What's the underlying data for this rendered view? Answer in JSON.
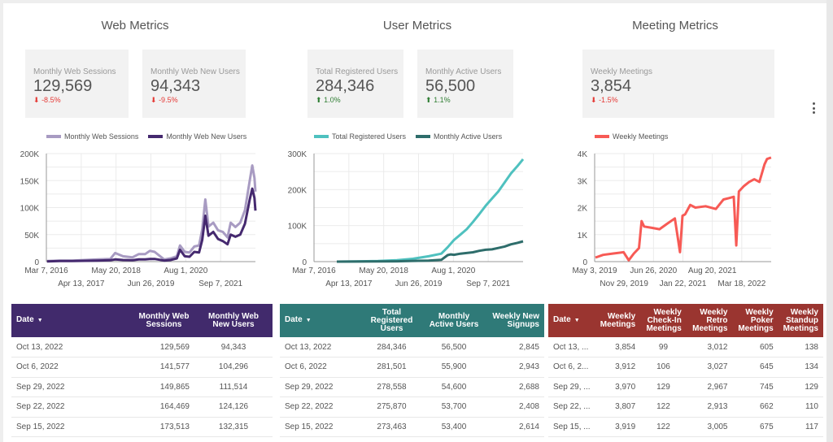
{
  "sections": [
    {
      "title": "Web Metrics",
      "kpis": [
        {
          "label": "Monthly Web Sessions",
          "value": "129,569",
          "delta": "-8.5%",
          "direction": "down",
          "icon": "arrow-down-icon"
        },
        {
          "label": "Monthly Web New Users",
          "value": "94,343",
          "delta": "-9.5%",
          "direction": "down",
          "icon": "arrow-down-icon"
        }
      ],
      "legend": [
        {
          "label": "Monthly Web Sessions",
          "color": "#a89bc2"
        },
        {
          "label": "Monthly Web New Users",
          "color": "#45296f"
        }
      ],
      "table": {
        "header_color": "#412a6c",
        "sort_icon": "sort-down-icon",
        "columns": [
          "Date",
          "Monthly Web Sessions",
          "Monthly Web New Users"
        ],
        "rows": [
          [
            "Oct 13, 2022",
            "129,569",
            "94,343"
          ],
          [
            "Oct 6, 2022",
            "141,577",
            "104,296"
          ],
          [
            "Sep 29, 2022",
            "149,865",
            "111,514"
          ],
          [
            "Sep 22, 2022",
            "164,469",
            "124,126"
          ],
          [
            "Sep 15, 2022",
            "173,513",
            "132,315"
          ]
        ]
      }
    },
    {
      "title": "User Metrics",
      "kpis": [
        {
          "label": "Total Registered Users",
          "value": "284,346",
          "delta": "1.0%",
          "direction": "up",
          "icon": "arrow-up-icon"
        },
        {
          "label": "Monthly Active Users",
          "value": "56,500",
          "delta": "1.1%",
          "direction": "up",
          "icon": "arrow-up-icon"
        }
      ],
      "legend": [
        {
          "label": "Total Registered Users",
          "color": "#4fc1bf"
        },
        {
          "label": "Monthly Active Users",
          "color": "#2e6d6b"
        }
      ],
      "table": {
        "header_color": "#2f7a78",
        "sort_icon": "sort-down-icon",
        "columns": [
          "Date",
          "Total Registered Users",
          "Monthly Active Users",
          "Weekly New Signups"
        ],
        "rows": [
          [
            "Oct 13, 2022",
            "284,346",
            "56,500",
            "2,845"
          ],
          [
            "Oct 6, 2022",
            "281,501",
            "55,900",
            "2,943"
          ],
          [
            "Sep 29, 2022",
            "278,558",
            "54,600",
            "2,688"
          ],
          [
            "Sep 22, 2022",
            "275,870",
            "53,700",
            "2,408"
          ],
          [
            "Sep 15, 2022",
            "273,463",
            "53,400",
            "2,614"
          ]
        ]
      }
    },
    {
      "title": "Meeting Metrics",
      "kpis": [
        {
          "label": "Weekly Meetings",
          "value": "3,854",
          "delta": "-1.5%",
          "direction": "down",
          "icon": "arrow-down-icon"
        }
      ],
      "legend": [
        {
          "label": "Weekly Meetings",
          "color": "#f75a55"
        }
      ],
      "table": {
        "header_color": "#9a3530",
        "sort_icon": "sort-down-icon",
        "columns": [
          "Date",
          "Weekly Meetings",
          "Weekly Check-In Meetings",
          "Weekly Retro Meetings",
          "Weekly Poker Meetings",
          "Weekly Standup Meetings"
        ],
        "rows": [
          [
            "Oct 13, ...",
            "3,854",
            "99",
            "3,012",
            "605",
            "138"
          ],
          [
            "Oct 6, 2...",
            "3,912",
            "106",
            "3,027",
            "645",
            "134"
          ],
          [
            "Sep 29, ...",
            "3,970",
            "129",
            "2,967",
            "745",
            "129"
          ],
          [
            "Sep 22, ...",
            "3,807",
            "122",
            "2,913",
            "662",
            "110"
          ],
          [
            "Sep 15, ...",
            "3,919",
            "122",
            "3,005",
            "675",
            "117"
          ]
        ]
      }
    }
  ],
  "more_menu_icon": "more-vertical-icon",
  "chart_data": [
    {
      "type": "line",
      "title": "",
      "xlabel": "",
      "ylabel": "",
      "x_ticks_row1": [
        "Mar 7, 2016",
        "May 20, 2018",
        "Aug 1, 2020"
      ],
      "x_ticks_row2": [
        "Apr 13, 2017",
        "Jun 26, 2019",
        "Sep 7, 2021"
      ],
      "y_ticks": [
        "0",
        "50K",
        "100K",
        "150K",
        "200K"
      ],
      "ylim": [
        0,
        200000
      ],
      "xlim": [
        "2016-03-07",
        "2022-10-13"
      ],
      "grid": true,
      "legend_position": "top",
      "x": [
        2016.2,
        2016.6,
        2017.0,
        2017.4,
        2017.8,
        2018.2,
        2018.35,
        2018.6,
        2018.9,
        2019.1,
        2019.3,
        2019.45,
        2019.6,
        2019.9,
        2020.1,
        2020.3,
        2020.4,
        2020.55,
        2020.7,
        2020.85,
        2021.0,
        2021.1,
        2021.2,
        2021.3,
        2021.45,
        2021.6,
        2021.75,
        2021.9,
        2022.0,
        2022.15,
        2022.3,
        2022.45,
        2022.6,
        2022.68,
        2022.75,
        2022.78
      ],
      "series": [
        {
          "name": "Monthly Web Sessions",
          "values": [
            1000,
            2000,
            2000,
            3000,
            4000,
            5000,
            16000,
            10000,
            8000,
            14000,
            14000,
            20000,
            18000,
            4000,
            6000,
            10000,
            30000,
            18000,
            17000,
            28000,
            30000,
            60000,
            115000,
            65000,
            72000,
            58000,
            55000,
            45000,
            72000,
            64000,
            72000,
            95000,
            150000,
            178000,
            155000,
            129569
          ]
        },
        {
          "name": "Monthly Web New Users",
          "values": [
            500,
            1000,
            1000,
            1500,
            2000,
            2500,
            4000,
            3000,
            2500,
            4000,
            4000,
            5000,
            5000,
            2000,
            3000,
            6000,
            22000,
            10000,
            9000,
            18000,
            17000,
            40000,
            85000,
            48000,
            55000,
            42000,
            38000,
            32000,
            50000,
            46000,
            50000,
            70000,
            115000,
            135000,
            118000,
            94343
          ]
        }
      ]
    },
    {
      "type": "line",
      "title": "",
      "xlabel": "",
      "ylabel": "",
      "x_ticks_row1": [
        "Mar 7, 2016",
        "May 20, 2018",
        "Aug 1, 2020"
      ],
      "x_ticks_row2": [
        "Apr 13, 2017",
        "Jun 26, 2019",
        "Sep 7, 2021"
      ],
      "y_ticks": [
        "0",
        "100K",
        "200K",
        "300K"
      ],
      "ylim": [
        0,
        300000
      ],
      "xlim": [
        "2016-03-07",
        "2022-10-13"
      ],
      "grid": true,
      "legend_position": "top",
      "x": [
        2016.9,
        2017.5,
        2018.2,
        2018.8,
        2019.3,
        2019.8,
        2020.2,
        2020.4,
        2020.5,
        2020.6,
        2020.8,
        2021.0,
        2021.2,
        2021.4,
        2021.6,
        2021.8,
        2022.0,
        2022.2,
        2022.4,
        2022.6,
        2022.78
      ],
      "series": [
        {
          "name": "Total Registered Users",
          "values": [
            0,
            500,
            1500,
            4000,
            8000,
            15000,
            22000,
            40000,
            50000,
            60000,
            75000,
            90000,
            110000,
            132000,
            155000,
            175000,
            195000,
            220000,
            245000,
            265000,
            284346
          ]
        },
        {
          "name": "Monthly Active Users",
          "values": [
            0,
            200,
            500,
            1000,
            2000,
            3000,
            5000,
            18000,
            20000,
            19000,
            22000,
            24000,
            26000,
            30000,
            33000,
            34000,
            38000,
            42000,
            48000,
            52000,
            56500
          ]
        }
      ]
    },
    {
      "type": "line",
      "title": "",
      "xlabel": "",
      "ylabel": "",
      "x_ticks_row1": [
        "May 3, 2019",
        "Jun 26, 2020",
        "Aug 20, 2021"
      ],
      "x_ticks_row2": [
        "Nov 29, 2019",
        "Jan 22, 2021",
        "Mar 18, 2022"
      ],
      "y_ticks": [
        "0",
        "1K",
        "2K",
        "3K",
        "4K"
      ],
      "ylim": [
        0,
        4000
      ],
      "xlim": [
        "2019-05-03",
        "2022-10-13"
      ],
      "grid": true,
      "legend_position": "top",
      "x": [
        2019.35,
        2019.5,
        2019.7,
        2019.9,
        2020.0,
        2020.1,
        2020.2,
        2020.25,
        2020.3,
        2020.45,
        2020.6,
        2020.75,
        2020.9,
        2021.0,
        2021.05,
        2021.1,
        2021.2,
        2021.3,
        2021.5,
        2021.7,
        2021.85,
        2021.95,
        2022.05,
        2022.1,
        2022.15,
        2022.25,
        2022.35,
        2022.45,
        2022.55,
        2022.65,
        2022.7,
        2022.78
      ],
      "series": [
        {
          "name": "Weekly Meetings",
          "values": [
            150,
            250,
            300,
            350,
            50,
            300,
            500,
            1500,
            1300,
            1250,
            1200,
            1400,
            1600,
            350,
            1700,
            1750,
            2100,
            2000,
            2050,
            1950,
            2300,
            2350,
            2400,
            600,
            2600,
            2800,
            2950,
            3050,
            2950,
            3600,
            3800,
            3854
          ]
        }
      ]
    }
  ]
}
